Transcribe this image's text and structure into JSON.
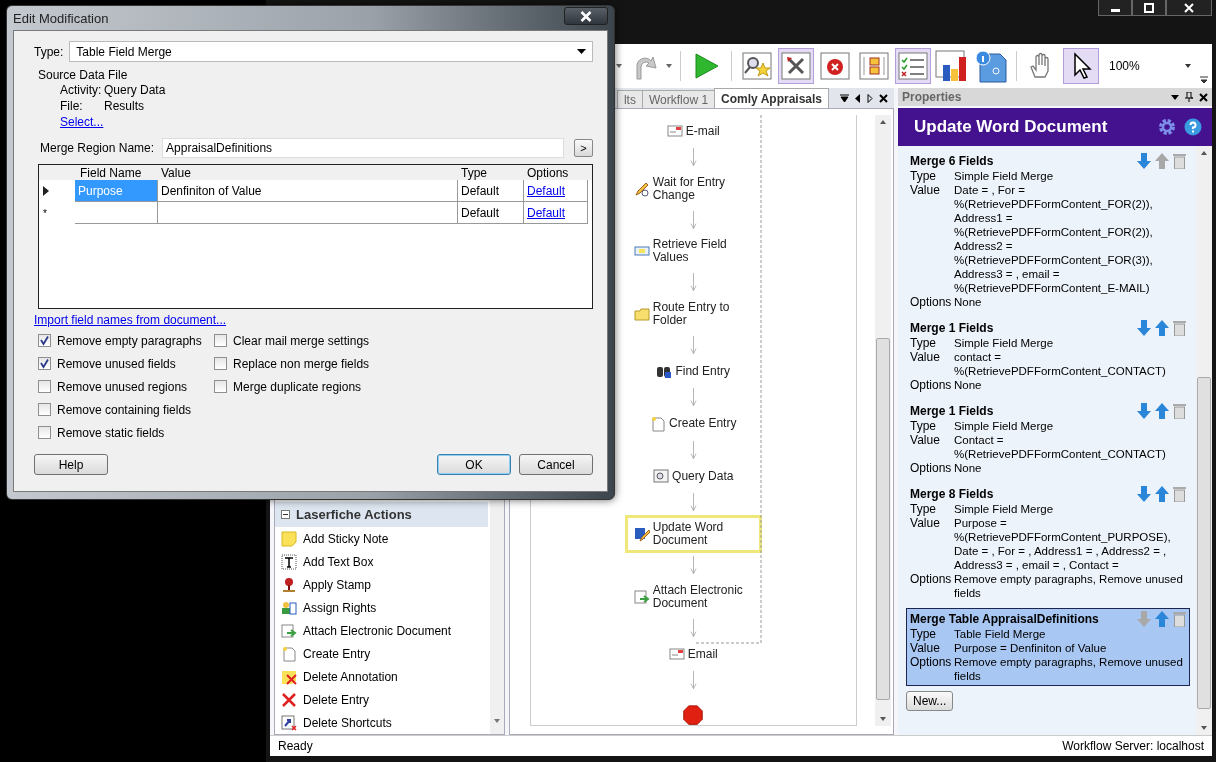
{
  "dialog": {
    "title": "Edit Modification",
    "type_label": "Type:",
    "type_value": "Table Field Merge",
    "source_heading": "Source Data File",
    "source_rows": [
      {
        "label": "Activity:",
        "value": "Query Data"
      },
      {
        "label": "File:",
        "value": "Results"
      }
    ],
    "select_link": "Select...",
    "region_label": "Merge Region Name:",
    "region_value": "AppraisalDefinitions",
    "region_button": ">",
    "grid": {
      "columns": [
        "Field Name",
        "Value",
        "Type",
        "Options"
      ],
      "rows": [
        {
          "current": true,
          "field_name": "Purpose",
          "value": "Denfiniton of Value",
          "type": "Default",
          "options": "Default",
          "selected": true
        },
        {
          "current": false,
          "marker": "*",
          "type": "Default",
          "options": "Default",
          "selected": false
        }
      ]
    },
    "import_link": "Import field names from document...",
    "option_columns": [
      [
        {
          "label": "Remove empty paragraphs",
          "checked": true
        },
        {
          "label": "Remove unused fields",
          "checked": true
        },
        {
          "label": "Remove unused regions",
          "checked": false
        },
        {
          "label": "Remove containing fields",
          "checked": false
        },
        {
          "label": "Remove static fields",
          "checked": false
        }
      ],
      [
        {
          "label": "Clear mail merge settings",
          "checked": false
        },
        {
          "label": "Replace non merge fields",
          "checked": false
        },
        {
          "label": "Merge duplicate regions",
          "checked": false
        }
      ]
    ],
    "buttons": [
      {
        "label": "Help",
        "default": false
      },
      {
        "label": "OK",
        "default": true
      },
      {
        "label": "Cancel",
        "default": false
      }
    ]
  },
  "toolbar": [
    {
      "kind": "caret"
    },
    {
      "kind": "redo",
      "selected": false
    },
    {
      "kind": "caret"
    },
    {
      "kind": "separator"
    },
    {
      "kind": "play",
      "selected": false
    },
    {
      "kind": "separator"
    },
    {
      "kind": "search-star",
      "selected": false
    },
    {
      "kind": "tools",
      "selected": true
    },
    {
      "kind": "stop",
      "selected": false
    },
    {
      "kind": "branch",
      "selected": false
    },
    {
      "kind": "checklist",
      "selected": true
    },
    {
      "kind": "chart",
      "selected": false
    },
    {
      "kind": "info",
      "selected": false
    },
    {
      "kind": "separator"
    },
    {
      "kind": "hand",
      "selected": false
    },
    {
      "kind": "cursor",
      "selected": true
    },
    {
      "kind": "zoom",
      "label": "100%"
    }
  ],
  "tabs": [
    {
      "label": "lts",
      "selected": false
    },
    {
      "label": "Workflow 1",
      "selected": false
    },
    {
      "label": "Comly Appraisals",
      "selected": true
    }
  ],
  "workflow": {
    "activities": [
      {
        "label": "E-mail",
        "selected": false
      },
      {
        "label": "Wait for Entry Change",
        "selected": false
      },
      {
        "label": "Retrieve Field Values",
        "selected": false
      },
      {
        "label": "Route Entry to Folder",
        "selected": false
      },
      {
        "label": "Find Entry",
        "selected": false
      },
      {
        "label": "Create Entry",
        "selected": false
      },
      {
        "label": "Query Data",
        "selected": false
      },
      {
        "label": "Update Word Document",
        "selected": true
      },
      {
        "label": "Attach Electronic Document",
        "selected": false
      },
      {
        "label": "Email",
        "selected": false
      }
    ]
  },
  "actions": {
    "title": "Laserfiche Actions",
    "expanded": true,
    "items": [
      "Add Sticky Note",
      "Add Text Box",
      "Apply Stamp",
      "Assign Rights",
      "Attach Electronic Document",
      "Create Entry",
      "Delete Annotation",
      "Delete Entry",
      "Delete Shortcuts"
    ]
  },
  "properties": {
    "title": "Properties",
    "banner": "Update Word Document",
    "merges": [
      {
        "title": "Merge 6 Fields",
        "can_move_down": true,
        "can_move_up": false,
        "selected": false,
        "rows": [
          {
            "label": "Type",
            "value": "Simple Field Merge"
          },
          {
            "label": "Value",
            "value": "Date = , For =\n%(RetrievePDFFormContent_FOR(2)),\nAddress1 =\n%(RetrievePDFFormContent_FOR(2)),\nAddress2 =\n%(RetrievePDFFormContent_FOR(3)),\nAddress3 = , email =\n%(RetrievePDFFormContent_E-MAIL)"
          },
          {
            "label": "Options",
            "value": "None"
          }
        ]
      },
      {
        "title": "Merge 1 Fields",
        "can_move_down": true,
        "can_move_up": true,
        "selected": false,
        "rows": [
          {
            "label": "Type",
            "value": "Simple Field Merge"
          },
          {
            "label": "Value",
            "value": "contact =\n%(RetrievePDFFormContent_CONTACT)"
          },
          {
            "label": "Options",
            "value": "None"
          }
        ]
      },
      {
        "title": "Merge 1 Fields",
        "can_move_down": true,
        "can_move_up": true,
        "selected": false,
        "rows": [
          {
            "label": "Type",
            "value": "Simple Field Merge"
          },
          {
            "label": "Value",
            "value": "Contact =\n%(RetrievePDFFormContent_CONTACT)"
          },
          {
            "label": "Options",
            "value": "None"
          }
        ]
      },
      {
        "title": "Merge 8 Fields",
        "can_move_down": true,
        "can_move_up": true,
        "selected": false,
        "rows": [
          {
            "label": "Type",
            "value": "Simple Field Merge"
          },
          {
            "label": "Value",
            "value": "Purpose =\n%(RetrievePDFFormContent_PURPOSE),\nDate = , For = , Address1 = , Address2 = ,\nAddress3 = , email = , Contact ="
          },
          {
            "label": "Options",
            "value": "Remove empty paragraphs, Remove unused\nfields"
          }
        ]
      },
      {
        "title": "Merge Table AppraisalDefinitions",
        "can_move_down": false,
        "can_move_up": true,
        "selected": true,
        "rows": [
          {
            "label": "Type",
            "value": "Table Field Merge"
          },
          {
            "label": "Value",
            "value": "Purpose = Denfiniton of Value"
          },
          {
            "label": "Options",
            "value": "Remove empty paragraphs, Remove unused\nfields"
          }
        ]
      }
    ],
    "new_button": "New..."
  },
  "status_bar": {
    "left": "Ready",
    "right": "Workflow Server: localhost"
  }
}
